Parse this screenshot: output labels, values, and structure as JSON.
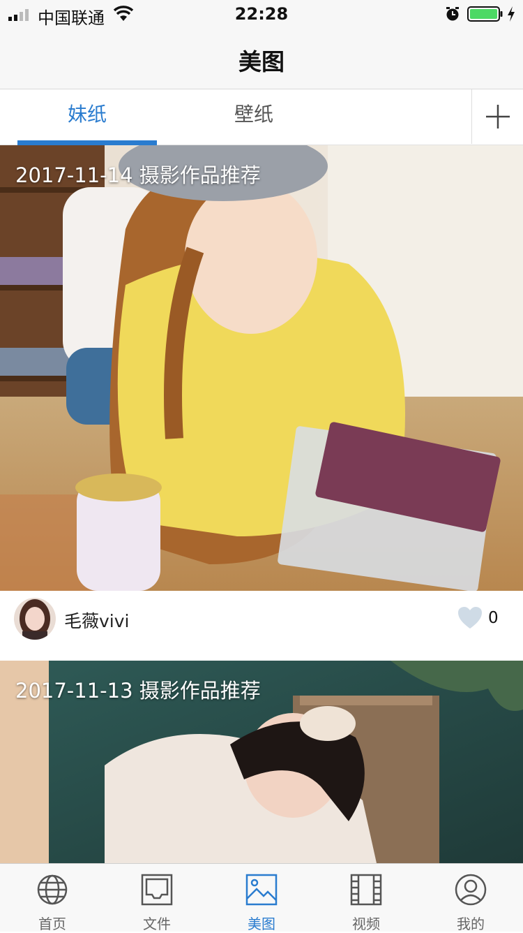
{
  "status_bar": {
    "carrier": "中国联通",
    "time": "22:28"
  },
  "nav": {
    "title": "美图"
  },
  "tabs": [
    {
      "label": "妹纸",
      "active": true
    },
    {
      "label": "壁纸",
      "active": false
    }
  ],
  "feed": [
    {
      "caption": "2017-11-14 摄影作品推荐",
      "author": "毛薇vivi",
      "likes": "0"
    },
    {
      "caption": "2017-11-13 摄影作品推荐"
    }
  ],
  "tabbar": [
    {
      "label": "首页",
      "icon": "globe-icon"
    },
    {
      "label": "文件",
      "icon": "inbox-icon"
    },
    {
      "label": "美图",
      "icon": "image-icon",
      "active": true
    },
    {
      "label": "视频",
      "icon": "film-icon"
    },
    {
      "label": "我的",
      "icon": "user-icon"
    }
  ],
  "colors": {
    "accent": "#2a7ccf",
    "heart": "#cfdbe6"
  }
}
